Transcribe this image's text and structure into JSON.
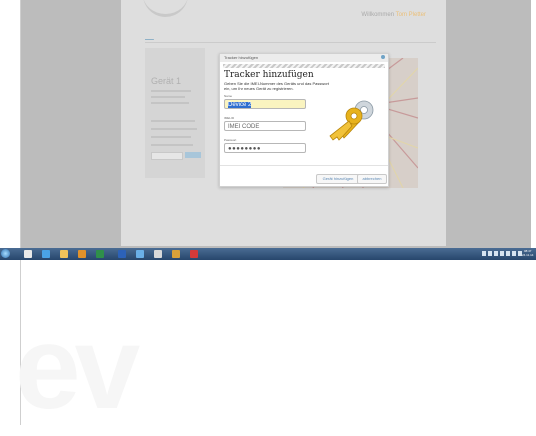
{
  "site": {
    "logo_text": "...",
    "welcome_prefix": "Willkommen",
    "welcome_user": "Tom Pletter",
    "welcome_sub": "..."
  },
  "panel": {
    "device_title": "Gerät 1"
  },
  "dialog": {
    "titlebar": "Tracker hinzufügen",
    "heading": "Tracker hinzufügen",
    "description": "Geben Sie die IMEI-Nummer des Geräts und das Passwort ein, um Ihr neues Gerät zu registrieren.",
    "name_label": "Name",
    "name_value": "Device 2",
    "imei_label": "IMEI-ID",
    "imei_placeholder": "IMEI CODE",
    "password_label": "Passwort",
    "password_value": "●●●●●●●●",
    "add_button": "Gerät hinzufügen",
    "cancel_button": "abbrechen"
  },
  "colors": {
    "accent": "#ebc07a",
    "link": "#5a87b4",
    "taskbar": "#27466c",
    "key_gold": "#e7b21c"
  },
  "taskbar": {
    "clock_time": "08:47",
    "clock_date": "24.11.14",
    "apps": [
      "windows-explorer",
      "internet-explorer",
      "folder",
      "outlook",
      "excel",
      "word",
      "photos",
      "mail",
      "chrome",
      "pdf"
    ]
  }
}
